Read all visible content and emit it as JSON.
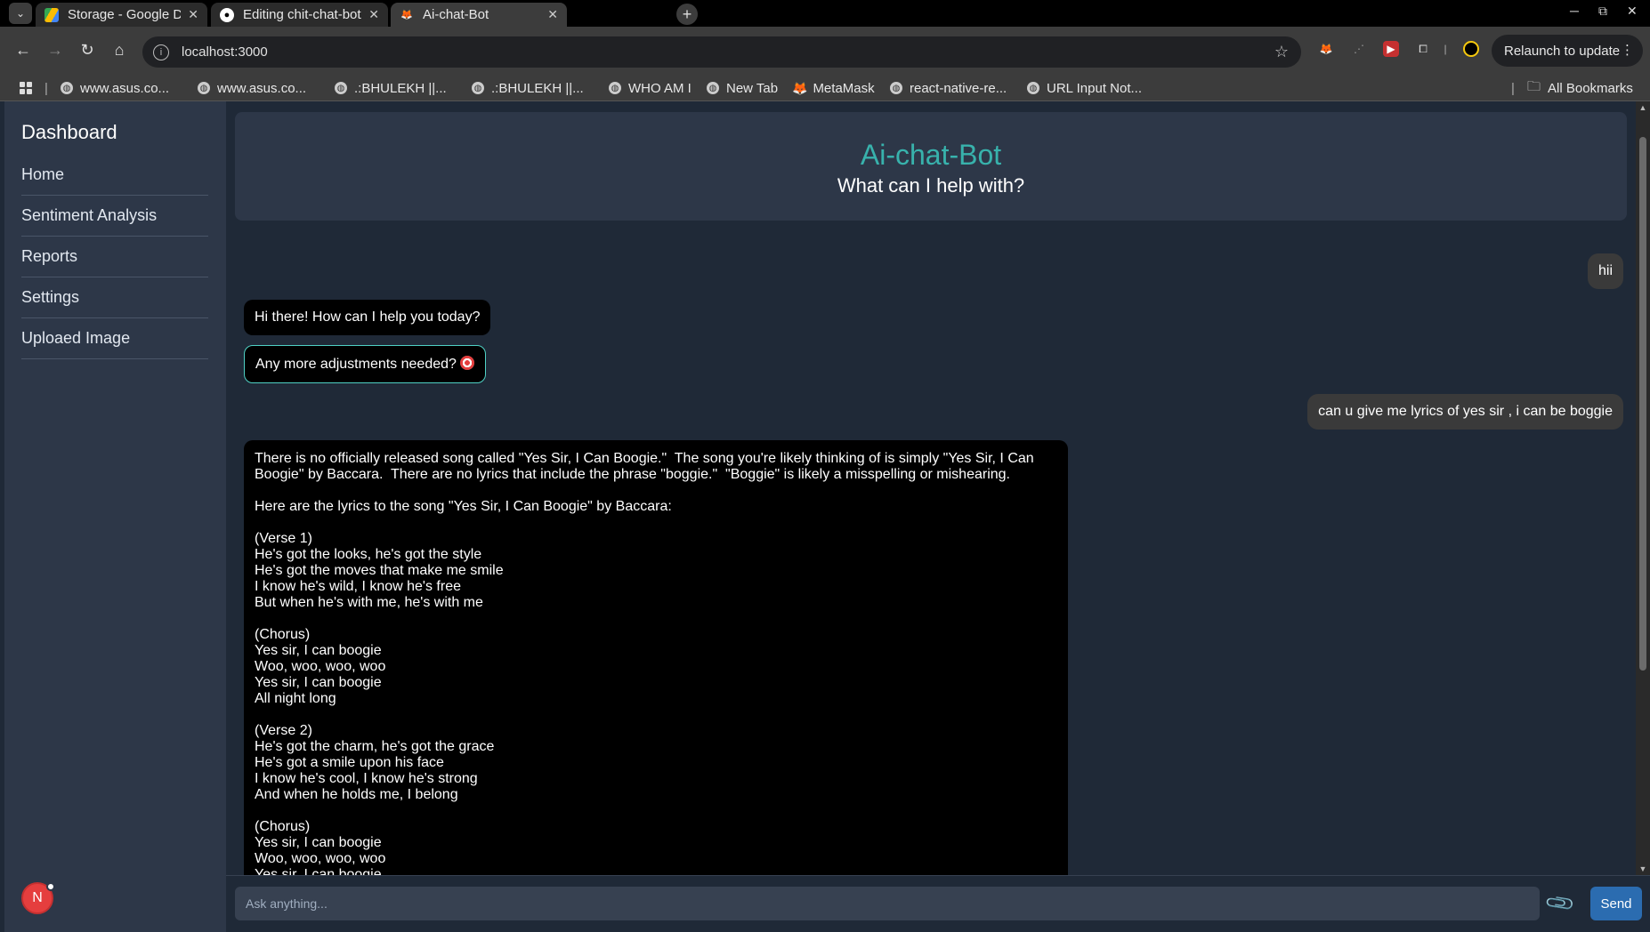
{
  "browser": {
    "tabs": [
      {
        "title": "Storage - Google Drive",
        "icon": "google-drive-icon",
        "active": false
      },
      {
        "title": "Editing chit-chat-bot/RE",
        "icon": "github-icon",
        "active": false
      },
      {
        "title": "Ai-chat-Bot",
        "icon": "fox-icon",
        "active": true
      }
    ],
    "url": "localhost:3000",
    "relaunch_label": "Relaunch to update",
    "bookmarks": [
      "www.asus.co...",
      "www.asus.co...",
      ".:BHULEKH ||...",
      ".:BHULEKH ||...",
      "WHO AM I",
      "New Tab",
      "MetaMask",
      "react-native-re...",
      "URL Input Not..."
    ],
    "all_bookmarks_label": "All Bookmarks"
  },
  "sidebar": {
    "title": "Dashboard",
    "items": [
      "Home",
      "Sentiment Analysis",
      "Reports",
      "Settings",
      "Uploaed Image"
    ],
    "avatar_initial": "N"
  },
  "header": {
    "title": "Ai-chat-Bot",
    "subtitle": "What can I help with?"
  },
  "messages": [
    {
      "role": "user",
      "text": "hii"
    },
    {
      "role": "bot",
      "text": "Hi there! How can I help you today?"
    },
    {
      "role": "bot",
      "text": "Any more adjustments needed?",
      "icon": "target-emoji"
    },
    {
      "role": "user",
      "text": "can u give me lyrics of yes sir , i can be boggie"
    },
    {
      "role": "bot",
      "text": "There is no officially released song called \"Yes Sir, I Can Boogie.\"  The song you're likely thinking of is simply \"Yes Sir, I Can Boogie\" by Baccara.  There are no lyrics that include the phrase \"boggie.\"  \"Boggie\" is likely a misspelling or mishearing.\n\nHere are the lyrics to the song \"Yes Sir, I Can Boogie\" by Baccara:\n\n(Verse 1)\nHe's got the looks, he's got the style\nHe's got the moves that make me smile\nI know he's wild, I know he's free\nBut when he's with me, he's with me\n\n(Chorus)\nYes sir, I can boogie\nWoo, woo, woo, woo\nYes sir, I can boogie\nAll night long\n\n(Verse 2)\nHe's got the charm, he's got the grace\nHe's got a smile upon his face\nI know he's cool, I know he's strong\nAnd when he holds me, I belong\n\n(Chorus)\nYes sir, I can boogie\nWoo, woo, woo, woo\nYes sir, I can boogie"
    }
  ],
  "composer": {
    "placeholder": "Ask anything...",
    "send_label": "Send"
  }
}
